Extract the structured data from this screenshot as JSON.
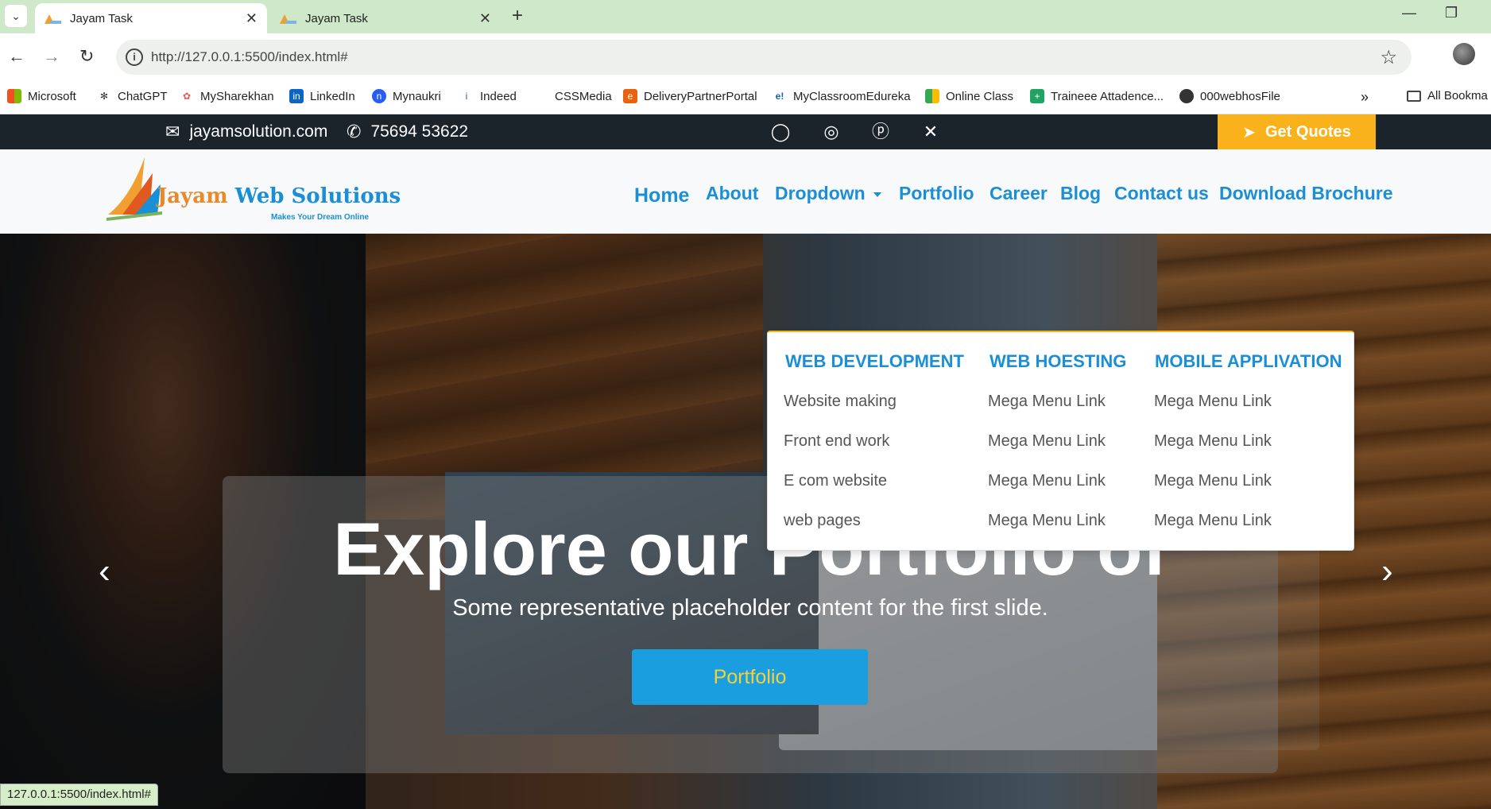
{
  "browser": {
    "tabs": [
      {
        "title": "Jayam Task",
        "active": true
      },
      {
        "title": "Jayam Task",
        "active": false
      }
    ],
    "url": "http://127.0.0.1:5500/index.html#",
    "status_url": "127.0.0.1:5500/index.html#",
    "bookmarks": [
      {
        "label": "Microsoft",
        "icon": "microsoft-icon"
      },
      {
        "label": "ChatGPT",
        "icon": "chatgpt-icon"
      },
      {
        "label": "MySharekhan",
        "icon": "sharekhan-icon"
      },
      {
        "label": "LinkedIn",
        "icon": "linkedin-icon"
      },
      {
        "label": "Mynaukri",
        "icon": "naukri-icon"
      },
      {
        "label": "Indeed",
        "icon": "indeed-icon"
      },
      {
        "label": "CSSMedia",
        "icon": "cssmedia-icon"
      },
      {
        "label": "DeliveryPartnerPortal",
        "icon": "delivery-icon"
      },
      {
        "label": "MyClassroomEdureka",
        "icon": "edureka-icon"
      },
      {
        "label": "Online Class",
        "icon": "meet-icon"
      },
      {
        "label": "Traineee Attadence...",
        "icon": "sheets-icon"
      },
      {
        "label": "000webhosFile",
        "icon": "globe-icon"
      }
    ],
    "all_bookmarks": "All Bookma"
  },
  "topbar": {
    "email": "jayamsolution.com",
    "phone": "75694 53622",
    "quote_button": "Get Quotes",
    "social_icons": [
      "whatsapp-icon",
      "instagram-icon",
      "pinterest-icon",
      "x-icon"
    ]
  },
  "header": {
    "logo_text_1": "Jayam",
    "logo_text_2": " Web Solutions",
    "logo_tagline": "Makes Your Dream Online",
    "nav": [
      "Home",
      "About",
      "Dropdown",
      "Portfolio",
      "Career",
      "Blog",
      "Contact us",
      "Download Brochure"
    ]
  },
  "mega_menu": {
    "columns": [
      {
        "heading": "WEB DEVELOPMENT",
        "links": [
          "Website making",
          "Front end work",
          "E com website",
          "web pages"
        ]
      },
      {
        "heading": "WEB HOESTING",
        "links": [
          "Mega Menu Link",
          "Mega Menu Link",
          "Mega Menu Link",
          "Mega Menu Link"
        ]
      },
      {
        "heading": "MOBILE APPLIVATION",
        "links": [
          "Mega Menu Link",
          "Mega Menu Link",
          "Mega Menu Link",
          "Mega Menu Link"
        ]
      }
    ]
  },
  "hero": {
    "title": "Explore our Portfolio of",
    "subtitle": "Some representative placeholder content for the first slide.",
    "button": "Portfolio"
  },
  "colors": {
    "brand_blue": "#1b8fd6",
    "accent_yellow": "#f9b21b",
    "topbar_bg": "#1b232b"
  }
}
